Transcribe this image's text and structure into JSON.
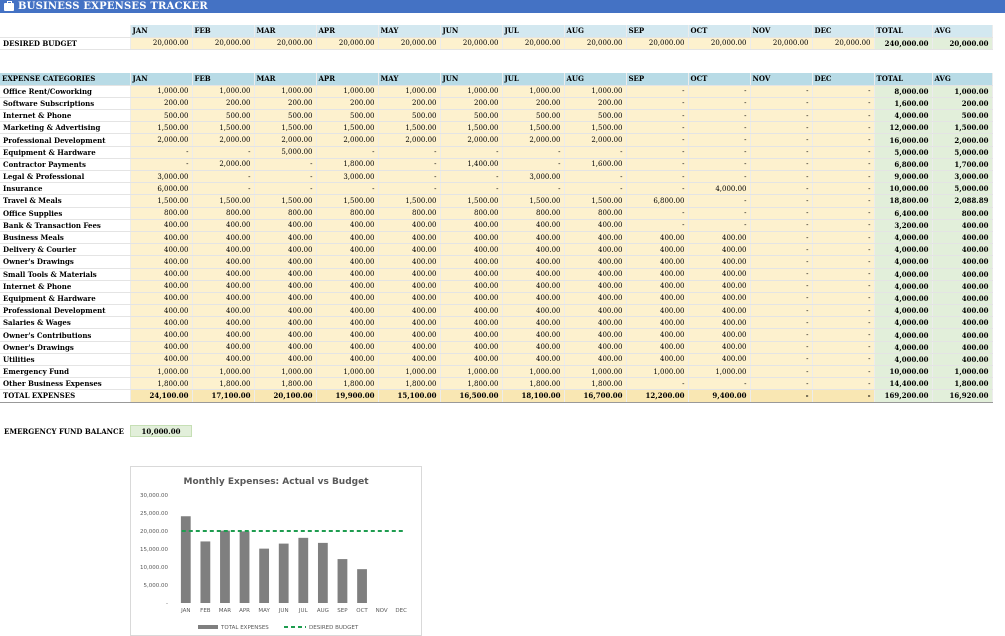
{
  "app": {
    "title": "BUSINESS EXPENSES TRACKER",
    "title_icon": "briefcase-icon"
  },
  "months": [
    "JAN",
    "FEB",
    "MAR",
    "APR",
    "MAY",
    "JUN",
    "JUL",
    "AUG",
    "SEP",
    "OCT",
    "NOV",
    "DEC"
  ],
  "total_label": "TOTAL",
  "avg_label": "AVG",
  "budget": {
    "label": "DESIRED BUDGET",
    "values": [
      "20,000.00",
      "20,000.00",
      "20,000.00",
      "20,000.00",
      "20,000.00",
      "20,000.00",
      "20,000.00",
      "20,000.00",
      "20,000.00",
      "20,000.00",
      "20,000.00",
      "20,000.00"
    ],
    "total": "240,000.00",
    "avg": "20,000.00"
  },
  "expenses": {
    "header": "EXPENSE CATEGORIES",
    "rows": [
      {
        "label": "Office Rent/Coworking",
        "values": [
          "1,000.00",
          "1,000.00",
          "1,000.00",
          "1,000.00",
          "1,000.00",
          "1,000.00",
          "1,000.00",
          "1,000.00",
          "-",
          "-",
          "-",
          "-"
        ],
        "total": "8,000.00",
        "avg": "1,000.00"
      },
      {
        "label": "Software Subscriptions",
        "values": [
          "200.00",
          "200.00",
          "200.00",
          "200.00",
          "200.00",
          "200.00",
          "200.00",
          "200.00",
          "-",
          "-",
          "-",
          "-"
        ],
        "total": "1,600.00",
        "avg": "200.00"
      },
      {
        "label": "Internet & Phone",
        "values": [
          "500.00",
          "500.00",
          "500.00",
          "500.00",
          "500.00",
          "500.00",
          "500.00",
          "500.00",
          "-",
          "-",
          "-",
          "-"
        ],
        "total": "4,000.00",
        "avg": "500.00"
      },
      {
        "label": "Marketing & Advertising",
        "values": [
          "1,500.00",
          "1,500.00",
          "1,500.00",
          "1,500.00",
          "1,500.00",
          "1,500.00",
          "1,500.00",
          "1,500.00",
          "-",
          "-",
          "-",
          "-"
        ],
        "total": "12,000.00",
        "avg": "1,500.00"
      },
      {
        "label": "Professional Development",
        "values": [
          "2,000.00",
          "2,000.00",
          "2,000.00",
          "2,000.00",
          "2,000.00",
          "2,000.00",
          "2,000.00",
          "2,000.00",
          "-",
          "-",
          "-",
          "-"
        ],
        "total": "16,000.00",
        "avg": "2,000.00"
      },
      {
        "label": "Equipment & Hardware",
        "values": [
          "-",
          "-",
          "5,000.00",
          "-",
          "-",
          "-",
          "-",
          "-",
          "-",
          "-",
          "-",
          "-"
        ],
        "total": "5,000.00",
        "avg": "5,000.00"
      },
      {
        "label": "Contractor Payments",
        "values": [
          "-",
          "2,000.00",
          "-",
          "1,800.00",
          "-",
          "1,400.00",
          "-",
          "1,600.00",
          "-",
          "-",
          "-",
          "-"
        ],
        "total": "6,800.00",
        "avg": "1,700.00"
      },
      {
        "label": "Legal & Professional",
        "values": [
          "3,000.00",
          "-",
          "-",
          "3,000.00",
          "-",
          "-",
          "3,000.00",
          "-",
          "-",
          "-",
          "-",
          "-"
        ],
        "total": "9,000.00",
        "avg": "3,000.00"
      },
      {
        "label": "Insurance",
        "values": [
          "6,000.00",
          "-",
          "-",
          "-",
          "-",
          "-",
          "-",
          "-",
          "-",
          "4,000.00",
          "-",
          "-"
        ],
        "total": "10,000.00",
        "avg": "5,000.00"
      },
      {
        "label": "Travel & Meals",
        "values": [
          "1,500.00",
          "1,500.00",
          "1,500.00",
          "1,500.00",
          "1,500.00",
          "1,500.00",
          "1,500.00",
          "1,500.00",
          "6,800.00",
          "-",
          "-",
          "-"
        ],
        "total": "18,800.00",
        "avg": "2,088.89"
      },
      {
        "label": "Office Supplies",
        "values": [
          "800.00",
          "800.00",
          "800.00",
          "800.00",
          "800.00",
          "800.00",
          "800.00",
          "800.00",
          "-",
          "-",
          "-",
          "-"
        ],
        "total": "6,400.00",
        "avg": "800.00"
      },
      {
        "label": "Bank & Transaction Fees",
        "values": [
          "400.00",
          "400.00",
          "400.00",
          "400.00",
          "400.00",
          "400.00",
          "400.00",
          "400.00",
          "-",
          "-",
          "-",
          "-"
        ],
        "total": "3,200.00",
        "avg": "400.00"
      },
      {
        "label": "Business Meals",
        "values": [
          "400.00",
          "400.00",
          "400.00",
          "400.00",
          "400.00",
          "400.00",
          "400.00",
          "400.00",
          "400.00",
          "400.00",
          "-",
          "-"
        ],
        "total": "4,000.00",
        "avg": "400.00"
      },
      {
        "label": "Delivery & Courier",
        "values": [
          "400.00",
          "400.00",
          "400.00",
          "400.00",
          "400.00",
          "400.00",
          "400.00",
          "400.00",
          "400.00",
          "400.00",
          "-",
          "-"
        ],
        "total": "4,000.00",
        "avg": "400.00"
      },
      {
        "label": "Owner's Drawings",
        "values": [
          "400.00",
          "400.00",
          "400.00",
          "400.00",
          "400.00",
          "400.00",
          "400.00",
          "400.00",
          "400.00",
          "400.00",
          "-",
          "-"
        ],
        "total": "4,000.00",
        "avg": "400.00"
      },
      {
        "label": "Small Tools & Materials",
        "values": [
          "400.00",
          "400.00",
          "400.00",
          "400.00",
          "400.00",
          "400.00",
          "400.00",
          "400.00",
          "400.00",
          "400.00",
          "-",
          "-"
        ],
        "total": "4,000.00",
        "avg": "400.00"
      },
      {
        "label": "Internet & Phone",
        "values": [
          "400.00",
          "400.00",
          "400.00",
          "400.00",
          "400.00",
          "400.00",
          "400.00",
          "400.00",
          "400.00",
          "400.00",
          "-",
          "-"
        ],
        "total": "4,000.00",
        "avg": "400.00"
      },
      {
        "label": "Equipment & Hardware",
        "values": [
          "400.00",
          "400.00",
          "400.00",
          "400.00",
          "400.00",
          "400.00",
          "400.00",
          "400.00",
          "400.00",
          "400.00",
          "-",
          "-"
        ],
        "total": "4,000.00",
        "avg": "400.00"
      },
      {
        "label": "Professional Development",
        "values": [
          "400.00",
          "400.00",
          "400.00",
          "400.00",
          "400.00",
          "400.00",
          "400.00",
          "400.00",
          "400.00",
          "400.00",
          "-",
          "-"
        ],
        "total": "4,000.00",
        "avg": "400.00"
      },
      {
        "label": "Salaries & Wages",
        "values": [
          "400.00",
          "400.00",
          "400.00",
          "400.00",
          "400.00",
          "400.00",
          "400.00",
          "400.00",
          "400.00",
          "400.00",
          "-",
          "-"
        ],
        "total": "4,000.00",
        "avg": "400.00"
      },
      {
        "label": "Owner's Contributions",
        "values": [
          "400.00",
          "400.00",
          "400.00",
          "400.00",
          "400.00",
          "400.00",
          "400.00",
          "400.00",
          "400.00",
          "400.00",
          "-",
          "-"
        ],
        "total": "4,000.00",
        "avg": "400.00"
      },
      {
        "label": "Owner's Drawings",
        "values": [
          "400.00",
          "400.00",
          "400.00",
          "400.00",
          "400.00",
          "400.00",
          "400.00",
          "400.00",
          "400.00",
          "400.00",
          "-",
          "-"
        ],
        "total": "4,000.00",
        "avg": "400.00"
      },
      {
        "label": "Utilities",
        "values": [
          "400.00",
          "400.00",
          "400.00",
          "400.00",
          "400.00",
          "400.00",
          "400.00",
          "400.00",
          "400.00",
          "400.00",
          "-",
          "-"
        ],
        "total": "4,000.00",
        "avg": "400.00"
      },
      {
        "label": "Emergency Fund",
        "values": [
          "1,000.00",
          "1,000.00",
          "1,000.00",
          "1,000.00",
          "1,000.00",
          "1,000.00",
          "1,000.00",
          "1,000.00",
          "1,000.00",
          "1,000.00",
          "-",
          "-"
        ],
        "total": "10,000.00",
        "avg": "1,000.00"
      },
      {
        "label": "Other Business Expenses",
        "values": [
          "1,800.00",
          "1,800.00",
          "1,800.00",
          "1,800.00",
          "1,800.00",
          "1,800.00",
          "1,800.00",
          "1,800.00",
          "-",
          "-",
          "-",
          "-"
        ],
        "total": "14,400.00",
        "avg": "1,800.00"
      }
    ],
    "totals": {
      "label": "TOTAL EXPENSES",
      "values": [
        "24,100.00",
        "17,100.00",
        "20,100.00",
        "19,900.00",
        "15,100.00",
        "16,500.00",
        "18,100.00",
        "16,700.00",
        "12,200.00",
        "9,400.00",
        "-",
        "-"
      ],
      "total": "169,200.00",
      "avg": "16,920.00"
    }
  },
  "emergency_fund": {
    "label": "EMERGENCY FUND BALANCE",
    "value": "10,000.00"
  },
  "chart_data": {
    "type": "bar",
    "title": "Monthly Expenses: Actual vs Budget",
    "categories": [
      "JAN",
      "FEB",
      "MAR",
      "APR",
      "MAY",
      "JUN",
      "JUL",
      "AUG",
      "SEP",
      "OCT",
      "NOV",
      "DEC"
    ],
    "y_tick_labels": [
      "30,000.00",
      "25,000.00",
      "20,000.00",
      "15,000.00",
      "10,000.00",
      "5,000.00",
      "-"
    ],
    "series": [
      {
        "name": "TOTAL EXPENSES",
        "kind": "bar",
        "color": "#7f7f7f",
        "values": [
          24100,
          17100,
          20100,
          19900,
          15100,
          16500,
          18100,
          16700,
          12200,
          9400,
          0,
          0
        ]
      },
      {
        "name": "DESIRED BUDGET",
        "kind": "line-dashed",
        "color": "#1e9c4f",
        "values": [
          20000,
          20000,
          20000,
          20000,
          20000,
          20000,
          20000,
          20000,
          20000,
          20000,
          20000,
          20000
        ]
      }
    ],
    "ylim": [
      0,
      30000
    ],
    "legend": "bottom",
    "grid": false
  }
}
